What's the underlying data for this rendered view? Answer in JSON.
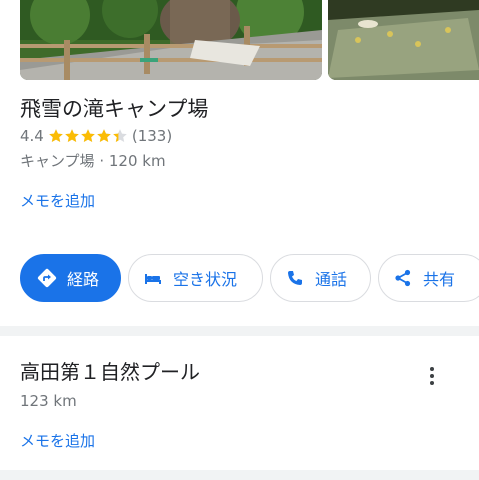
{
  "place": {
    "name": "飛雪の滝キャンプ場",
    "rating": "4.4",
    "rating_stars": 4.4,
    "review_count": "(133)",
    "category_distance": "キャンプ場 · 120 km",
    "add_memo": "メモを追加"
  },
  "actions": {
    "route": "経路",
    "vacancy": "空き状況",
    "call": "通話",
    "share": "共有"
  },
  "icons": {
    "route": "directions-icon",
    "vacancy": "bed-icon",
    "call": "phone-icon",
    "share": "share-icon",
    "more": "more-vert-icon"
  },
  "next_place": {
    "name": "高田第１自然プール",
    "distance": "123 km",
    "add_memo": "メモを追加"
  },
  "colors": {
    "accent": "#1a73e8",
    "star": "#fbbc04",
    "text_primary": "#202124",
    "text_secondary": "#70757a"
  }
}
